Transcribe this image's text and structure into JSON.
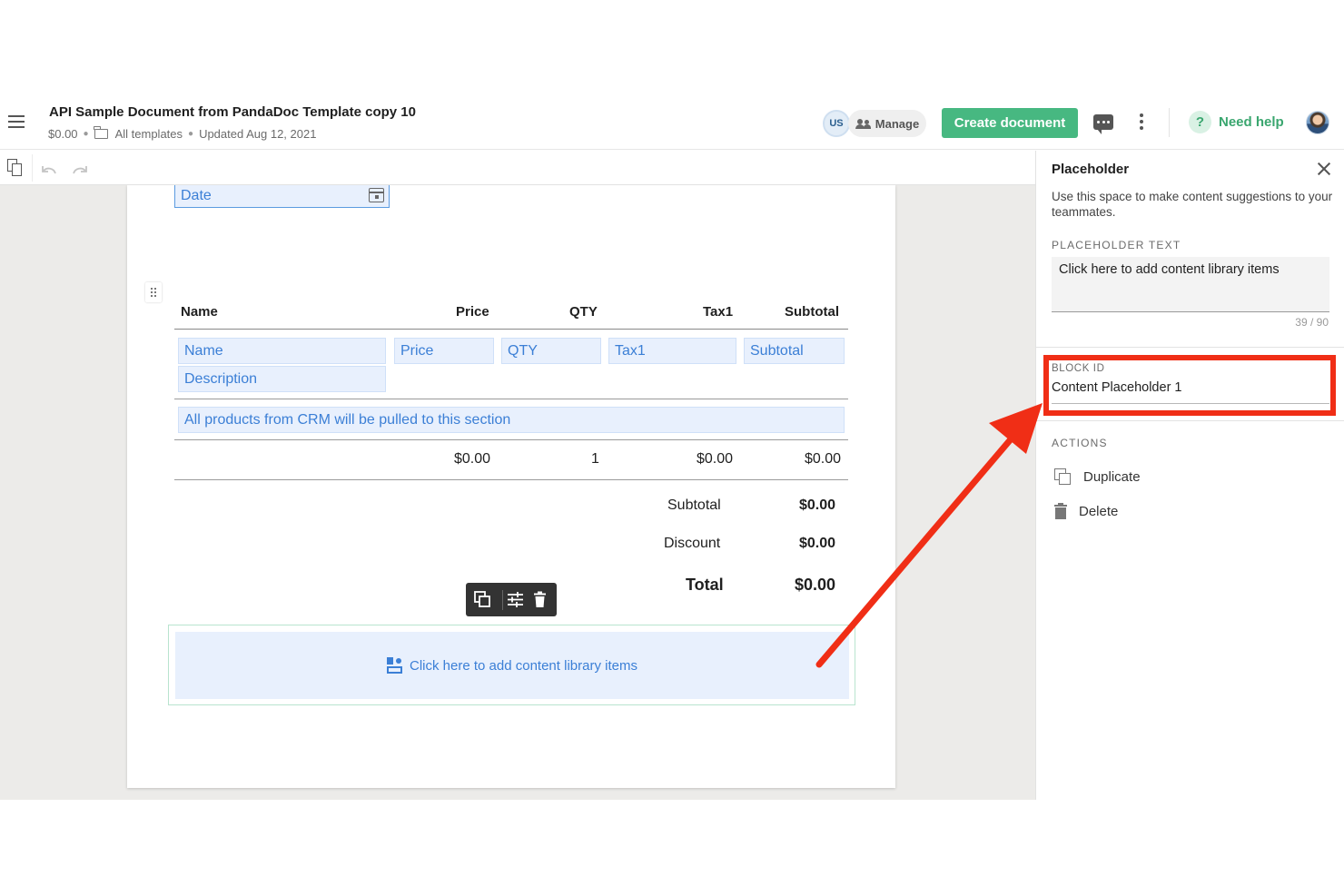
{
  "header": {
    "doc_title": "API Sample Document from PandaDoc Template copy 10",
    "amount": "$0.00",
    "folder": "All templates",
    "updated": "Updated Aug 12, 2021",
    "user_badge": "US",
    "manage_label": "Manage",
    "create_label": "Create document",
    "help_label": "Need help",
    "help_symbol": "?"
  },
  "document": {
    "date_field": "Date",
    "table": {
      "headers": [
        "Name",
        "Price",
        "QTY",
        "Tax1",
        "Subtotal"
      ],
      "field_placeholders": {
        "name": "Name",
        "price": "Price",
        "qty": "QTY",
        "tax": "Tax1",
        "subtotal": "Subtotal",
        "description": "Description"
      },
      "crm_note": "All products from CRM will be pulled to this section",
      "row": {
        "price": "$0.00",
        "qty": "1",
        "tax": "$0.00",
        "subtotal": "$0.00"
      }
    },
    "summary": {
      "subtotal_label": "Subtotal",
      "subtotal_value": "$0.00",
      "discount_label": "Discount",
      "discount_value": "$0.00",
      "total_label": "Total",
      "total_value": "$0.00"
    },
    "content_library": "Click here to add content library items"
  },
  "panel": {
    "title": "Placeholder",
    "description": "Use this space to make content suggestions to your teammates.",
    "placeholder_text_label": "PLACEHOLDER TEXT",
    "placeholder_text": "Click here to add content library items",
    "char_count": "39 / 90",
    "block_id_label": "BLOCK ID",
    "block_id_value": "Content Placeholder 1",
    "actions_label": "ACTIONS",
    "duplicate_label": "Duplicate",
    "delete_label": "Delete"
  },
  "colors": {
    "accent_green": "#47b881",
    "field_blue": "#3b7fd6",
    "field_bg": "#e8f0fd",
    "annotation_red": "#f02e16"
  }
}
